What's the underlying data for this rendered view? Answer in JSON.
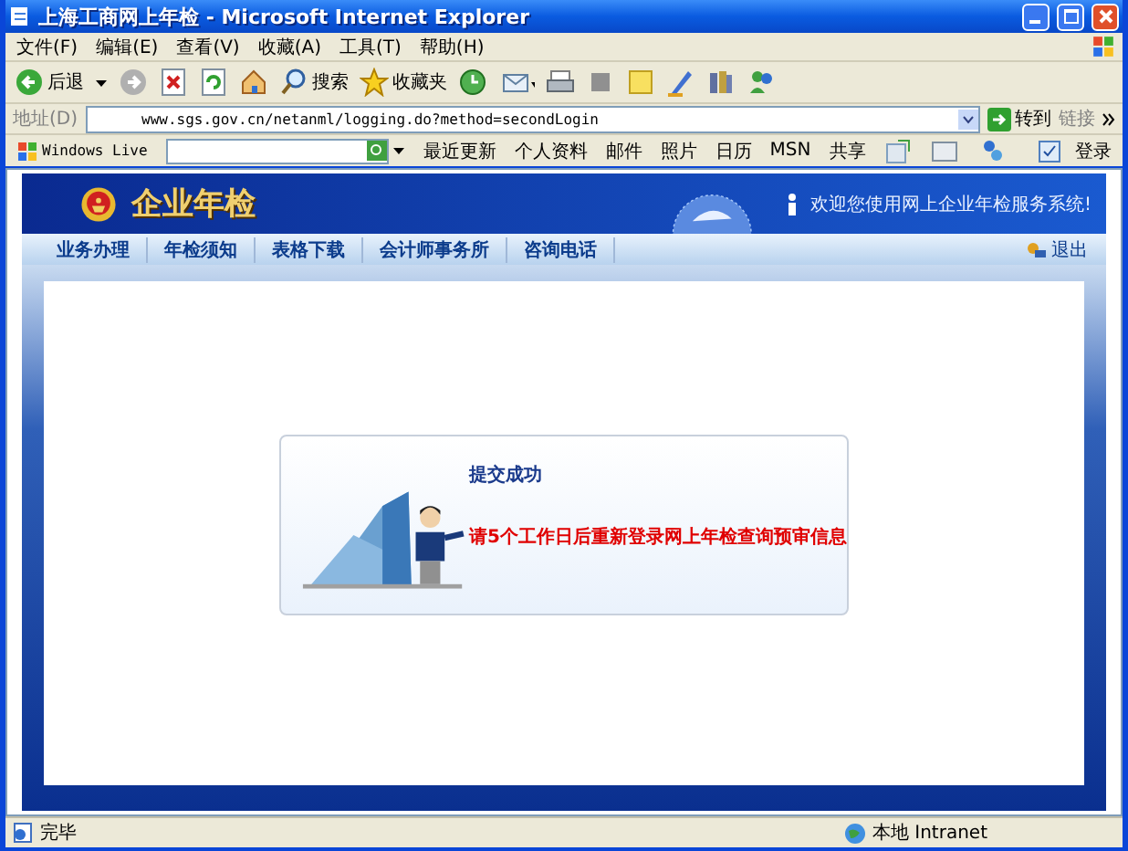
{
  "window": {
    "title": "上海工商网上年检 - Microsoft Internet Explorer"
  },
  "menu": [
    "文件(F)",
    "编辑(E)",
    "查看(V)",
    "收藏(A)",
    "工具(T)",
    "帮助(H)"
  ],
  "toolbar": {
    "back": "后退",
    "search": "搜索",
    "favorites": "收藏夹"
  },
  "address_bar": {
    "label": "地址(D)",
    "url": "www.sgs.gov.cn/netanml/logging.do?method=secondLogin",
    "go": "转到",
    "links": "链接"
  },
  "live_bar": {
    "brand": "Windows Live",
    "items": [
      "最近更新",
      "个人资料",
      "邮件",
      "照片",
      "日历",
      "MSN",
      "共享"
    ],
    "sign_in": "登录"
  },
  "site": {
    "logo_text": "企业年检",
    "welcome": "欢迎您使用网上企业年检服务系统!",
    "nav": [
      "业务办理",
      "年检须知",
      "表格下载",
      "会计师事务所",
      "咨询电话"
    ],
    "logout": "退出"
  },
  "message": {
    "title": "提交成功",
    "text": "请5个工作日后重新登录网上年检查询预审信息"
  },
  "status_bar": {
    "text": "完毕",
    "zone": "本地 Intranet"
  }
}
